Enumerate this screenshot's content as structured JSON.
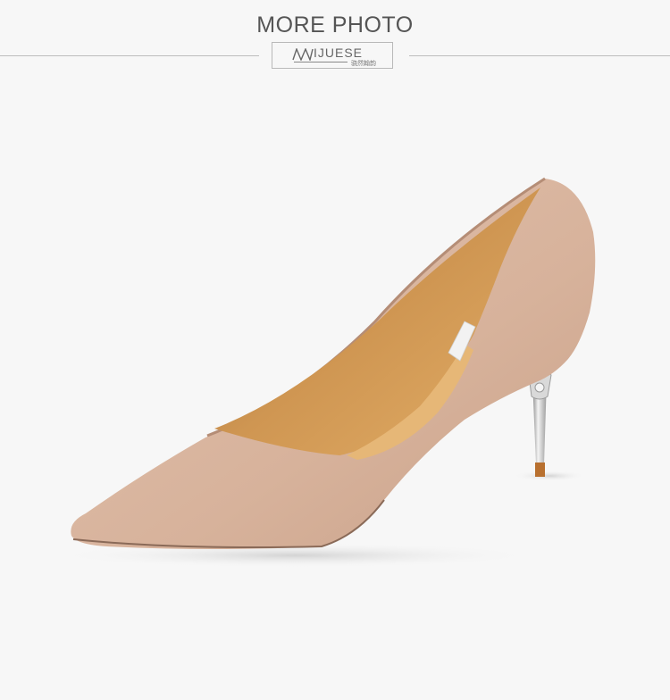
{
  "header": {
    "title": "MORE PHOTO",
    "brand": "IJUESE",
    "brand_sub": "骁然翰韵"
  },
  "photo": {
    "subject": "pump-shoe",
    "colors": {
      "background": "#f7f7f7",
      "suede": "#ddb9a3",
      "lining": "#c38a4c",
      "heel": "#cfcfcf"
    }
  }
}
